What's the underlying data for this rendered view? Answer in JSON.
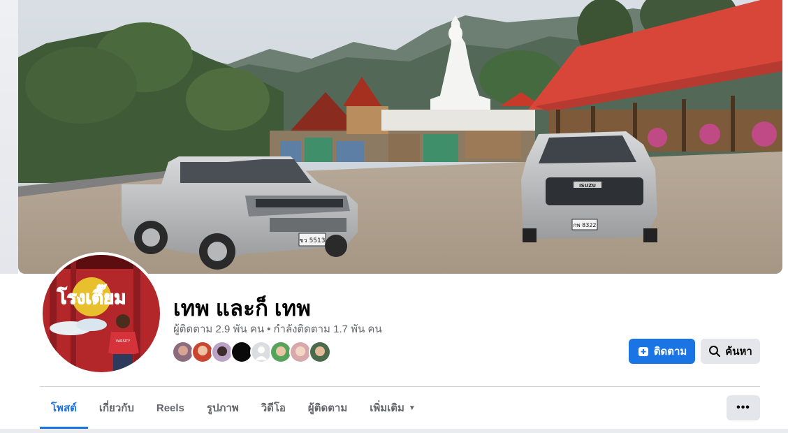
{
  "page": {
    "name": "เทพ และก็ เทพ",
    "followers": "ผู้ติดตาม 2.9 พัน คน",
    "following": "กำลังติดตาม 1.7 พัน คน",
    "separator": "•"
  },
  "actions": {
    "follow_label": "ติดตาม",
    "search_label": "ค้นหา",
    "more_label": "•••"
  },
  "tabs": [
    {
      "label": "โพสต์",
      "active": true
    },
    {
      "label": "เกี่ยวกับ"
    },
    {
      "label": "Reels"
    },
    {
      "label": "รูปภาพ"
    },
    {
      "label": "วิดีโอ"
    },
    {
      "label": "ผู้ติดตาม"
    },
    {
      "label": "เพิ่มเติม",
      "caret": "▼"
    }
  ],
  "cover": {
    "left_plate": "ขว 5513",
    "right_plate": "กพ 8322",
    "right_badge": "ISUZU"
  },
  "avatar_sign": "โรงเตี๊ยม",
  "avatar_shirt": "VARSITY",
  "colors": {
    "accent": "#1b74e4",
    "muted_text": "#65676b",
    "button_gray": "#e4e6eb"
  }
}
